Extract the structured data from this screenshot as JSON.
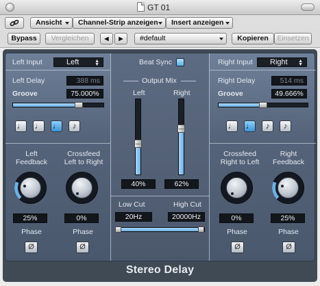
{
  "window": {
    "title": "GT 01"
  },
  "toolbar": {
    "link_icon": "link-icon",
    "view_label": "Ansicht",
    "channel_strip_label": "Channel-Strip anzeigen",
    "insert_label": "Insert anzeigen",
    "bypass_label": "Bypass",
    "compare_label": "Vergleichen",
    "prev_label": "◀",
    "next_label": "▶",
    "preset": "#default",
    "copy_label": "Kopieren",
    "paste_label": "Einsetzen"
  },
  "plugin": {
    "name": "Stereo Delay",
    "beat_sync": {
      "label": "Beat Sync",
      "enabled": true
    },
    "left": {
      "input_label": "Left Input",
      "input_value": "Left",
      "delay_label": "Left Delay",
      "delay_value": "388 ms",
      "groove_label": "Groove",
      "groove_value": "75.000%",
      "groove_fraction": 0.75,
      "notes": [
        {
          "icon": "note-half-icon",
          "glyph": "♩",
          "active": false
        },
        {
          "icon": "note-quarter-icon",
          "glyph": "♩",
          "active": false
        },
        {
          "icon": "note-eighth-icon",
          "glyph": "♩",
          "active": true
        },
        {
          "icon": "note-sixteenth-icon",
          "glyph": "♪",
          "active": false
        }
      ],
      "feedback_label": "Left\nFeedback",
      "feedback_value": "25%",
      "feedback_fraction": 0.25,
      "crossfeed_label": "Crossfeed\nLeft to Right",
      "crossfeed_value": "0%",
      "crossfeed_fraction": 0.0,
      "phase_label_1": "Phase",
      "phase_label_2": "Phase",
      "phase_glyph": "Ø"
    },
    "right": {
      "input_label": "Right Input",
      "input_value": "Right",
      "delay_label": "Right Delay",
      "delay_value": "514 ms",
      "groove_label": "Groove",
      "groove_value": "49.666%",
      "groove_fraction": 0.4967,
      "notes": [
        {
          "icon": "note-half-icon",
          "glyph": "♩",
          "active": false
        },
        {
          "icon": "note-quarter-icon",
          "glyph": "♩",
          "active": true
        },
        {
          "icon": "note-eighth-icon",
          "glyph": "♪",
          "active": false
        },
        {
          "icon": "note-sixteenth-icon",
          "glyph": "♪",
          "active": false
        }
      ],
      "crossfeed_label": "Crossfeed\nRight to Left",
      "crossfeed_value": "0%",
      "crossfeed_fraction": 0.0,
      "feedback_label": "Right\nFeedback",
      "feedback_value": "25%",
      "feedback_fraction": 0.25,
      "phase_label_1": "Phase",
      "phase_label_2": "Phase",
      "phase_glyph": "Ø"
    },
    "output_mix": {
      "label": "Output Mix",
      "left_label": "Left",
      "left_value": "40%",
      "left_fraction": 0.4,
      "right_label": "Right",
      "right_value": "62%",
      "right_fraction": 0.62
    },
    "filter": {
      "low_cut_label": "Low Cut",
      "low_cut_value": "20Hz",
      "high_cut_label": "High Cut",
      "high_cut_value": "20000Hz"
    }
  },
  "colors": {
    "accent": "#6db0e4",
    "panel": "#55647a",
    "display": "#13161b"
  }
}
